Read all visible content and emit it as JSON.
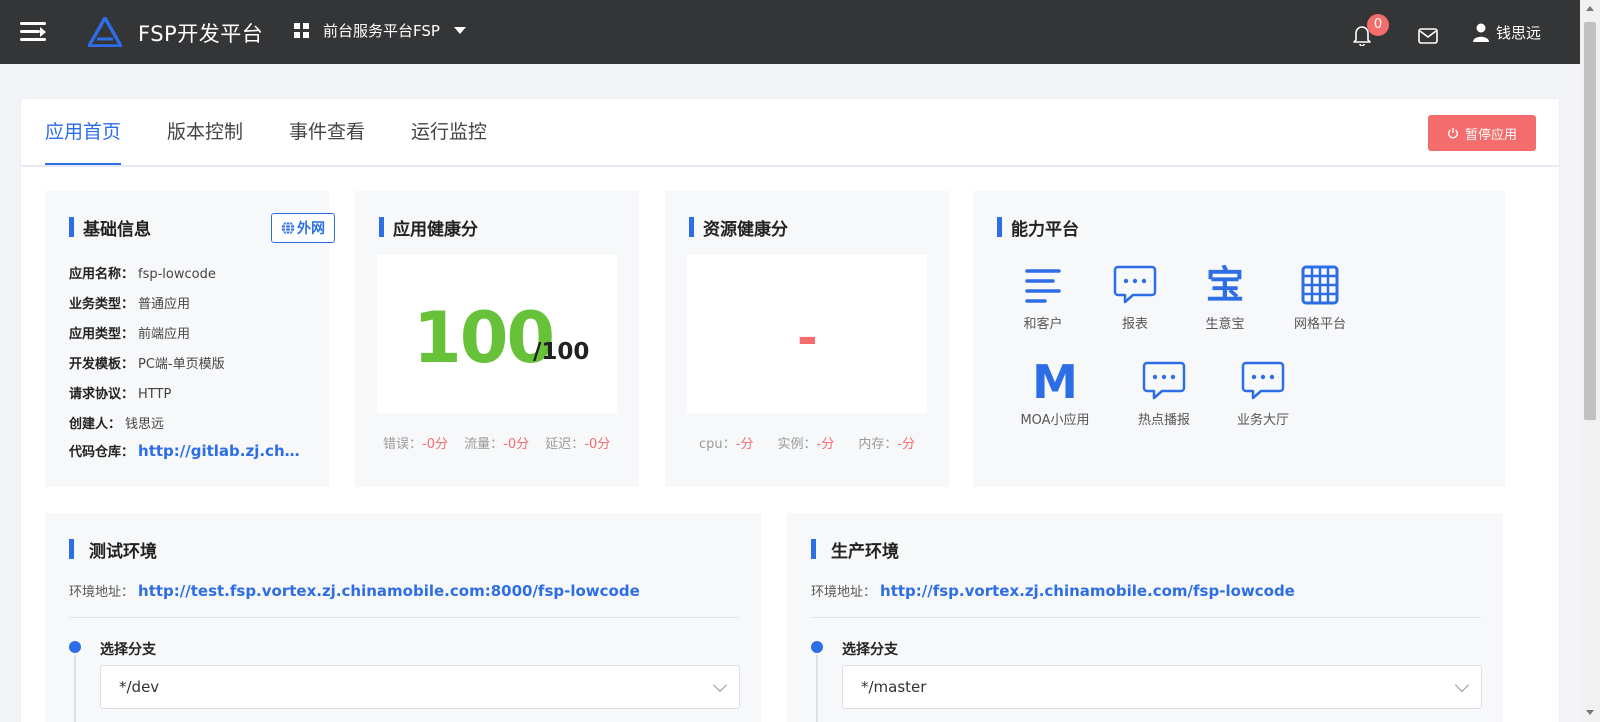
{
  "header": {
    "app_title": "FSP开发平台",
    "platform": "前台服务平台FSP",
    "notification_count": "0",
    "user_name": "钱思远"
  },
  "tabs": [
    {
      "label": "应用首页",
      "active": true
    },
    {
      "label": "版本控制",
      "active": false
    },
    {
      "label": "事件查看",
      "active": false
    },
    {
      "label": "运行监控",
      "active": false
    }
  ],
  "pause_button": "暂停应用",
  "basic_info": {
    "title": "基础信息",
    "net_tag": "外网",
    "rows": [
      {
        "key": "应用名称：",
        "value": "fsp-lowcode"
      },
      {
        "key": "业务类型：",
        "value": "普通应用"
      },
      {
        "key": "应用类型：",
        "value": "前端应用"
      },
      {
        "key": "开发模板：",
        "value": "PC端-单页模版"
      },
      {
        "key": "请求协议：",
        "value": "HTTP"
      },
      {
        "key": "创建人：",
        "value": "钱思远"
      },
      {
        "key": "代码仓库：",
        "value": "http://gitlab.zj.chinamobile.com/fsp-lowcode"
      }
    ]
  },
  "app_health": {
    "title": "应用健康分",
    "score": "100",
    "total": "/100",
    "metrics": [
      {
        "label": "错误：",
        "value": "-0分"
      },
      {
        "label": "流量：",
        "value": "-0分"
      },
      {
        "label": "延迟：",
        "value": "-0分"
      }
    ]
  },
  "resource_health": {
    "title": "资源健康分",
    "score": "-",
    "metrics": [
      {
        "label": "cpu：",
        "value": "-分"
      },
      {
        "label": "实例：",
        "value": "-分"
      },
      {
        "label": "内存：",
        "value": "-分"
      }
    ]
  },
  "capability": {
    "title": "能力平台",
    "items": [
      {
        "label": "和客户",
        "icon": "lines-icon"
      },
      {
        "label": "报表",
        "icon": "chat-icon"
      },
      {
        "label": "生意宝",
        "icon": "bao-icon",
        "glyph": "宝"
      },
      {
        "label": "网格平台",
        "icon": "grid-icon"
      },
      {
        "label": "MOA小应用",
        "icon": "m-icon",
        "glyph": "M"
      },
      {
        "label": "热点播报",
        "icon": "chat-icon"
      },
      {
        "label": "业务大厅",
        "icon": "chat-icon"
      }
    ]
  },
  "test_env": {
    "title": "测试环境",
    "addr_label": "环境地址：",
    "addr": "http://test.fsp.vortex.zj.chinamobile.com:8000/fsp-lowcode",
    "branch_label": "选择分支",
    "branch": "*/dev"
  },
  "prod_env": {
    "title": "生产环境",
    "addr_label": "环境地址：",
    "addr": "http://fsp.vortex.zj.chinamobile.com/fsp-lowcode",
    "branch_label": "选择分支",
    "branch": "*/master"
  },
  "colors": {
    "accent": "#2d6ee6",
    "danger": "#f56c6c",
    "success": "#67c23a",
    "topbar": "#343537"
  }
}
